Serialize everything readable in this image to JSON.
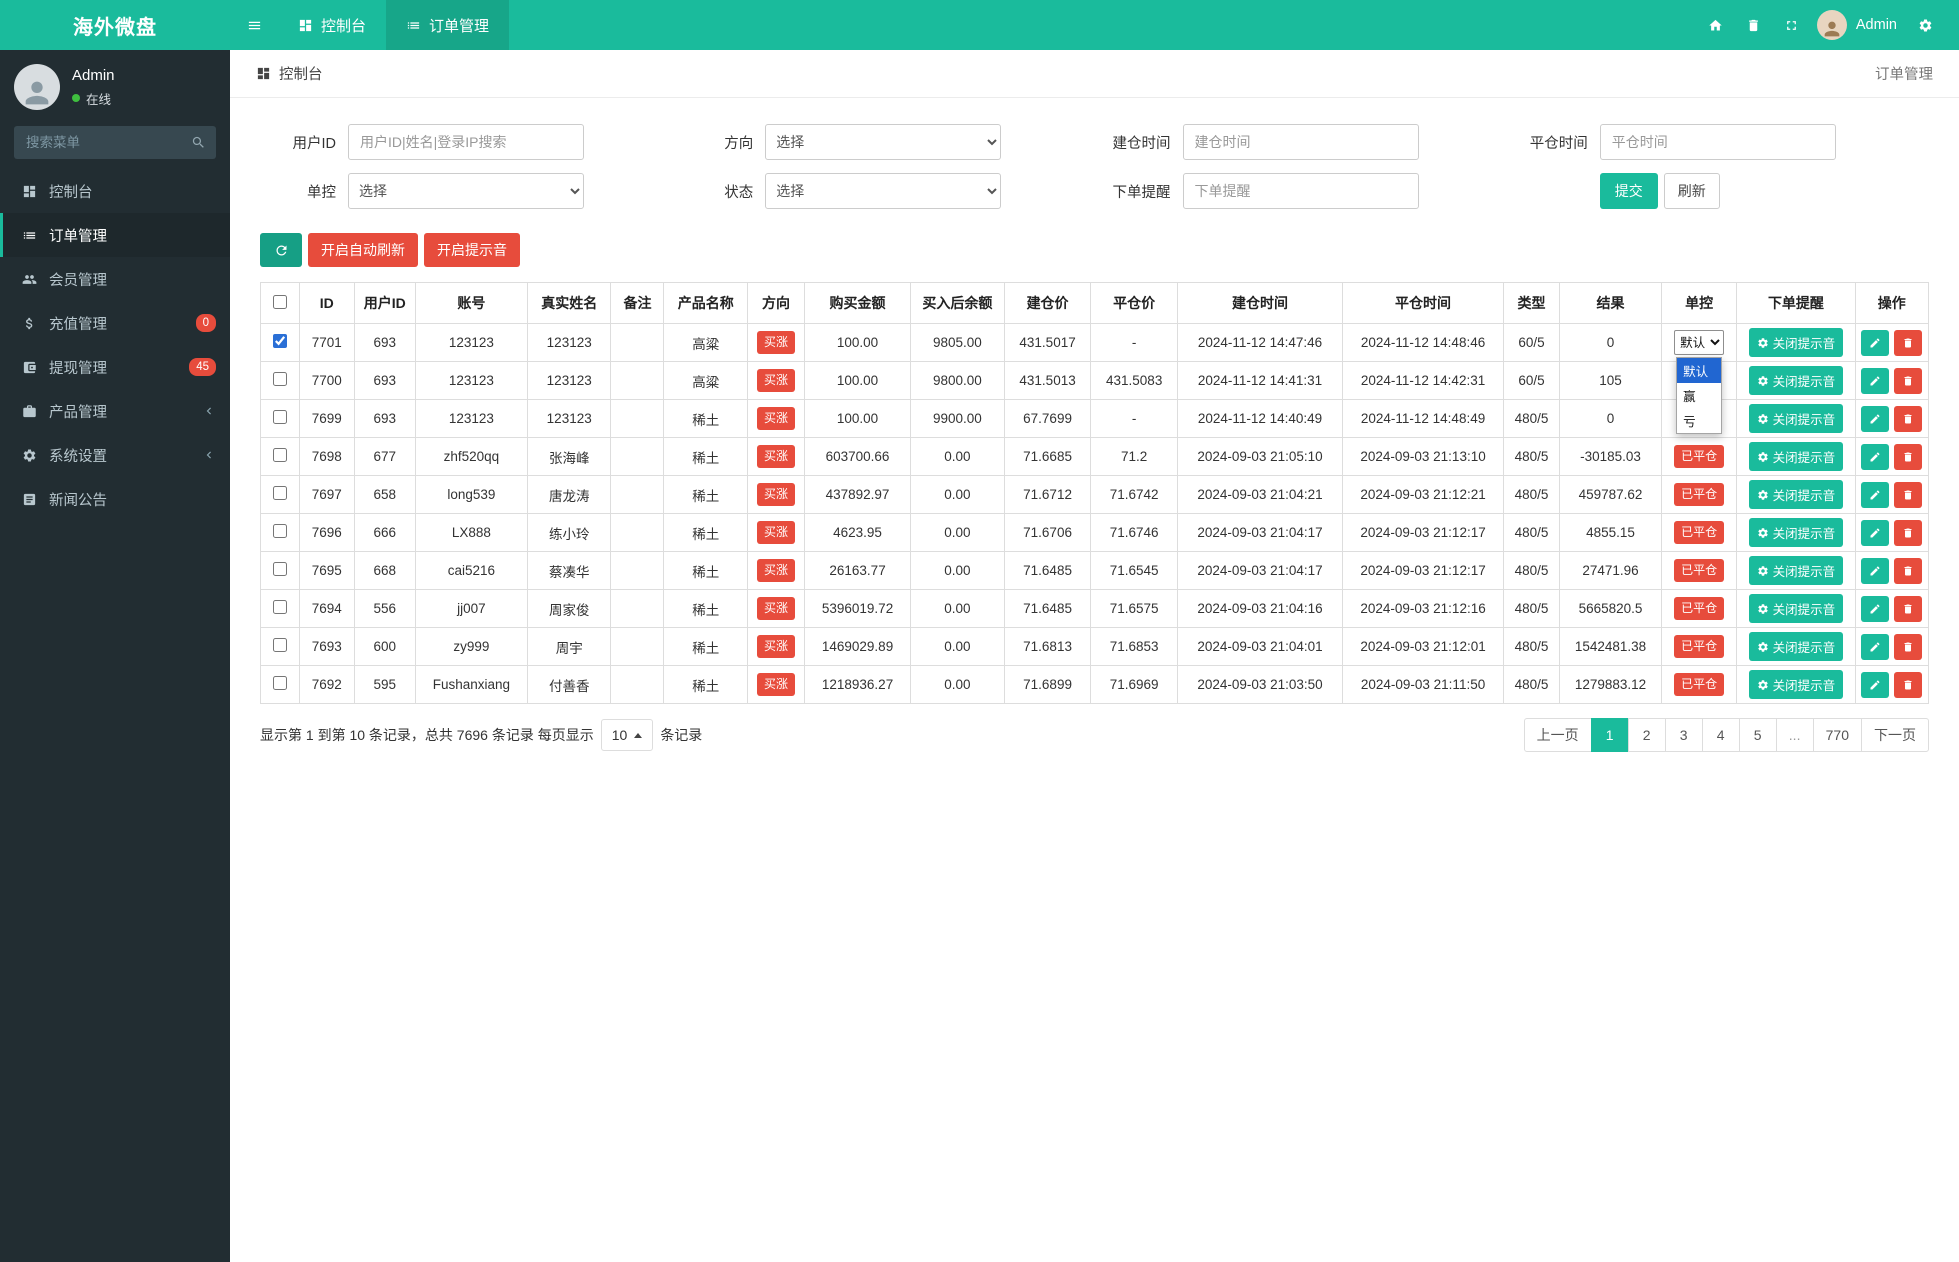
{
  "colors": {
    "primary": "#1ABB9C",
    "primary_dark": "#17A689",
    "danger": "#E74C3C",
    "sidebar_bg": "#222D32",
    "sidebar_active_bg": "#1E282C",
    "dropdown_highlight": "#2166D1"
  },
  "app": {
    "title": "海外微盘"
  },
  "topbar": {
    "tabs": [
      {
        "id": "console",
        "label": "控制台",
        "icon": "dashboard-icon",
        "active": false
      },
      {
        "id": "orders",
        "label": "订单管理",
        "icon": "list-icon",
        "active": true
      }
    ],
    "user_label": "Admin"
  },
  "sidebar": {
    "user": {
      "name": "Admin",
      "status": "在线"
    },
    "search_placeholder": "搜索菜单",
    "items": [
      {
        "id": "console",
        "label": "控制台",
        "icon": "dashboard-icon",
        "active": false
      },
      {
        "id": "orders",
        "label": "订单管理",
        "icon": "list-icon",
        "active": true
      },
      {
        "id": "members",
        "label": "会员管理",
        "icon": "users-icon"
      },
      {
        "id": "recharge",
        "label": "充值管理",
        "icon": "money-icon",
        "badge": "0"
      },
      {
        "id": "withdraw",
        "label": "提现管理",
        "icon": "wallet-icon",
        "badge": "45"
      },
      {
        "id": "products",
        "label": "产品管理",
        "icon": "briefcase-icon",
        "chevron": true
      },
      {
        "id": "settings",
        "label": "系统设置",
        "icon": "gear-icon",
        "chevron": true
      },
      {
        "id": "news",
        "label": "新闻公告",
        "icon": "news-icon"
      }
    ]
  },
  "breadcrumb": {
    "left": "控制台",
    "right": "订单管理"
  },
  "filters": {
    "user_id": {
      "label": "用户ID",
      "placeholder": "用户ID|姓名|登录IP搜索"
    },
    "direction": {
      "label": "方向",
      "value": "选择"
    },
    "open_time": {
      "label": "建仓时间",
      "placeholder": "建仓时间"
    },
    "close_time": {
      "label": "平仓时间",
      "placeholder": "平仓时间"
    },
    "control": {
      "label": "单控",
      "value": "选择"
    },
    "status": {
      "label": "状态",
      "value": "选择"
    },
    "order_notice": {
      "label": "下单提醒",
      "placeholder": "下单提醒"
    },
    "submit_label": "提交",
    "refresh_label": "刷新"
  },
  "toolbar": {
    "auto_refresh_label": "开启自动刷新",
    "sound_label": "开启提示音"
  },
  "table": {
    "columns": [
      "ID",
      "用户ID",
      "账号",
      "真实姓名",
      "备注",
      "产品名称",
      "方向",
      "购买金额",
      "买入后余额",
      "建仓价",
      "平仓价",
      "建仓时间",
      "平仓时间",
      "类型",
      "结果",
      "单控",
      "下单提醒",
      "操作"
    ],
    "closed_label": "已平仓",
    "sound_button_label": "关闭提示音",
    "rows": [
      {
        "checked": true,
        "id": "7701",
        "user_id": "693",
        "account": "123123",
        "real_name": "123123",
        "remark": "",
        "product": "高粱",
        "direction": "买涨",
        "amount": "100.00",
        "balance_after": "9805.00",
        "open_price": "431.5017",
        "close_price": "-",
        "open_time": "2024-11-12 14:47:46",
        "close_time": "2024-11-12 14:48:46",
        "type": "60/5",
        "result": "0",
        "control": "select"
      },
      {
        "id": "7700",
        "user_id": "693",
        "account": "123123",
        "real_name": "123123",
        "remark": "",
        "product": "高粱",
        "direction": "买涨",
        "amount": "100.00",
        "balance_after": "9800.00",
        "open_price": "431.5013",
        "close_price": "431.5083",
        "open_time": "2024-11-12 14:41:31",
        "close_time": "2024-11-12 14:42:31",
        "type": "60/5",
        "result": "105",
        "control": "hidden"
      },
      {
        "id": "7699",
        "user_id": "693",
        "account": "123123",
        "real_name": "123123",
        "remark": "",
        "product": "稀土",
        "direction": "买涨",
        "amount": "100.00",
        "balance_after": "9900.00",
        "open_price": "67.7699",
        "close_price": "-",
        "open_time": "2024-11-12 14:40:49",
        "close_time": "2024-11-12 14:48:49",
        "type": "480/5",
        "result": "0",
        "control": "hidden"
      },
      {
        "id": "7698",
        "user_id": "677",
        "account": "zhf520qq",
        "real_name": "张海峰",
        "remark": "",
        "product": "稀土",
        "direction": "买涨",
        "amount": "603700.66",
        "balance_after": "0.00",
        "open_price": "71.6685",
        "close_price": "71.2",
        "open_time": "2024-09-03 21:05:10",
        "close_time": "2024-09-03 21:13:10",
        "type": "480/5",
        "result": "-30185.03",
        "control": "closed"
      },
      {
        "id": "7697",
        "user_id": "658",
        "account": "long539",
        "real_name": "唐龙涛",
        "remark": "",
        "product": "稀土",
        "direction": "买涨",
        "amount": "437892.97",
        "balance_after": "0.00",
        "open_price": "71.6712",
        "close_price": "71.6742",
        "open_time": "2024-09-03 21:04:21",
        "close_time": "2024-09-03 21:12:21",
        "type": "480/5",
        "result": "459787.62",
        "control": "closed"
      },
      {
        "id": "7696",
        "user_id": "666",
        "account": "LX888",
        "real_name": "练小玲",
        "remark": "",
        "product": "稀土",
        "direction": "买涨",
        "amount": "4623.95",
        "balance_after": "0.00",
        "open_price": "71.6706",
        "close_price": "71.6746",
        "open_time": "2024-09-03 21:04:17",
        "close_time": "2024-09-03 21:12:17",
        "type": "480/5",
        "result": "4855.15",
        "control": "closed"
      },
      {
        "id": "7695",
        "user_id": "668",
        "account": "cai5216",
        "real_name": "蔡凑华",
        "remark": "",
        "product": "稀土",
        "direction": "买涨",
        "amount": "26163.77",
        "balance_after": "0.00",
        "open_price": "71.6485",
        "close_price": "71.6545",
        "open_time": "2024-09-03 21:04:17",
        "close_time": "2024-09-03 21:12:17",
        "type": "480/5",
        "result": "27471.96",
        "control": "closed"
      },
      {
        "id": "7694",
        "user_id": "556",
        "account": "jj007",
        "real_name": "周家俊",
        "remark": "",
        "product": "稀土",
        "direction": "买涨",
        "amount": "5396019.72",
        "balance_after": "0.00",
        "open_price": "71.6485",
        "close_price": "71.6575",
        "open_time": "2024-09-03 21:04:16",
        "close_time": "2024-09-03 21:12:16",
        "type": "480/5",
        "result": "5665820.5",
        "control": "closed"
      },
      {
        "id": "7693",
        "user_id": "600",
        "account": "zy999",
        "real_name": "周宇",
        "remark": "",
        "product": "稀土",
        "direction": "买涨",
        "amount": "1469029.89",
        "balance_after": "0.00",
        "open_price": "71.6813",
        "close_price": "71.6853",
        "open_time": "2024-09-03 21:04:01",
        "close_time": "2024-09-03 21:12:01",
        "type": "480/5",
        "result": "1542481.38",
        "control": "closed"
      },
      {
        "id": "7692",
        "user_id": "595",
        "account": "Fushanxiang",
        "real_name": "付善香",
        "remark": "",
        "product": "稀土",
        "direction": "买涨",
        "amount": "1218936.27",
        "balance_after": "0.00",
        "open_price": "71.6899",
        "close_price": "71.6969",
        "open_time": "2024-09-03 21:03:50",
        "close_time": "2024-09-03 21:11:50",
        "type": "480/5",
        "result": "1279883.12",
        "control": "closed"
      }
    ]
  },
  "control_dropdown": {
    "selected": "默认",
    "options": [
      "默认",
      "赢",
      "亏"
    ]
  },
  "pagination": {
    "info_prefix": "显示第 1 到第 10 条记录，总共 7696 条记录 每页显示",
    "page_size": "10",
    "info_suffix": "条记录",
    "pages": [
      {
        "label": "上一页",
        "type": "nav"
      },
      {
        "label": "1",
        "active": true
      },
      {
        "label": "2"
      },
      {
        "label": "3"
      },
      {
        "label": "4"
      },
      {
        "label": "5"
      },
      {
        "label": "...",
        "disabled": true
      },
      {
        "label": "770"
      },
      {
        "label": "下一页",
        "type": "nav"
      }
    ]
  }
}
